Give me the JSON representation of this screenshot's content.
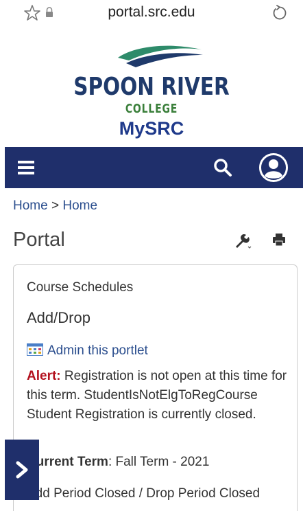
{
  "browser": {
    "url": "portal.src.edu"
  },
  "logo": {
    "title": "SPOON RIVER",
    "subtitle": "COLLEGE",
    "product": "MySRC"
  },
  "navbar": {
    "color": "#1f2f6b"
  },
  "breadcrumb": {
    "home": "Home",
    "separator": ">",
    "current": "Home"
  },
  "page": {
    "title": "Portal"
  },
  "portlet": {
    "title": "Course Schedules",
    "subtitle": "Add/Drop",
    "admin_link": "Admin this portlet",
    "alert_label": "Alert:",
    "alert_text": " Registration is not open at this time for this term. StudentIsNotElgToRegCourse Student Registration is currently closed.",
    "term_label": "Current Term",
    "term_value": ": Fall Term - 2021",
    "periods": "Add Period Closed / Drop Period Closed"
  },
  "icons": {
    "browser": [
      "star-icon",
      "lock-icon",
      "reload-icon"
    ],
    "navbar": [
      "menu-icon",
      "search-icon",
      "user-icon"
    ],
    "toolbar": [
      "wrench-icon",
      "printer-icon"
    ],
    "slide_tab": "chevron-right-icon"
  }
}
